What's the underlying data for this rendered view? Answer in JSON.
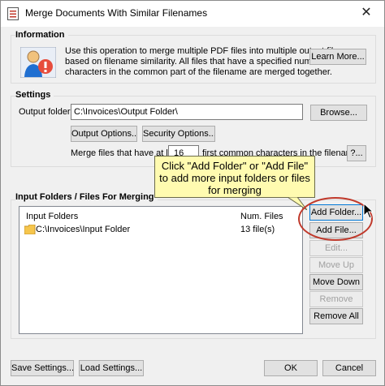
{
  "window": {
    "title": "Merge Documents With Similar Filenames",
    "close": "✕"
  },
  "information": {
    "label": "Information",
    "lines": [
      "Use this operation to merge multiple PDF files into multiple output files",
      "based on filename similarity. All files that have a specified number of",
      "characters in the common part of the filename are merged together."
    ],
    "learn_more": "Learn More..."
  },
  "settings": {
    "label": "Settings",
    "output_folder_label": "Output folder:",
    "output_folder_value": "C:\\Invoices\\Output Folder\\",
    "browse": "Browse...",
    "output_options": "Output Options...",
    "security_options": "Security Options...",
    "merge_prefix": "Merge files that have at least",
    "merge_count": "16",
    "merge_suffix": "first common characters in the filename",
    "help": "?..."
  },
  "callout": {
    "lines": [
      "Click \"Add Folder\" or \"Add File\"",
      "to add more input folders or files",
      "for merging"
    ]
  },
  "input": {
    "label": "Input Folders / Files For Merging",
    "col_folders": "Input Folders",
    "col_files": "Num. Files",
    "rows": [
      {
        "name": "C:\\Invoices\\Input Folder",
        "files": "13 file(s)"
      }
    ],
    "add_folder": "Add Folder...",
    "add_file": "Add File...",
    "edit": "Edit...",
    "move_up": "Move Up",
    "move_down": "Move Down",
    "remove": "Remove",
    "remove_all": "Remove All"
  },
  "footer": {
    "save_settings": "Save Settings...",
    "load_settings": "Load Settings...",
    "ok": "OK",
    "cancel": "Cancel"
  }
}
